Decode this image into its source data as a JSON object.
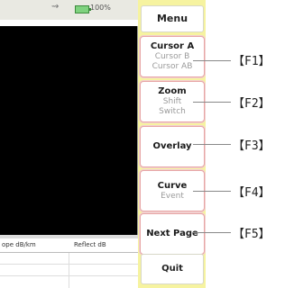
{
  "status": {
    "battery_text": "100%",
    "icon_glyph": "⇝"
  },
  "readout": {
    "left": "ope dB/km",
    "right": "Reflect dB"
  },
  "menu": {
    "title": "Menu",
    "buttons": [
      {
        "main": "Cursor A",
        "subs": [
          "Cursor B",
          "Cursor AB"
        ],
        "key": "【F1】"
      },
      {
        "main": "Zoom",
        "subs": [
          "Shift",
          "Switch"
        ],
        "key": "【F2】"
      },
      {
        "main": "Overlay",
        "subs": [],
        "key": "【F3】"
      },
      {
        "main": "Curve",
        "subs": [
          "Event"
        ],
        "key": "【F4】"
      },
      {
        "main": "Next Page",
        "subs": [],
        "key": "【F5】"
      }
    ],
    "quit": "Quit"
  }
}
